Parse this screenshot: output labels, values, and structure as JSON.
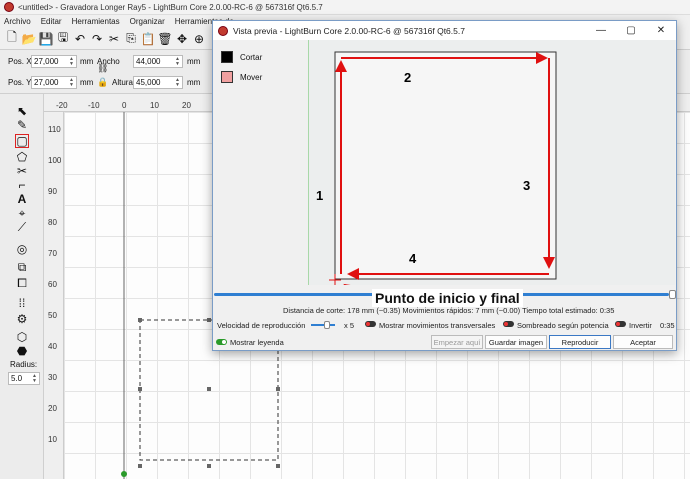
{
  "main_window": {
    "title": "<untitled> - Gravadora Longer Ray5 - LightBurn Core 2.0.00-RC-6 @ 567316f Qt6.5.7",
    "menu": [
      "Archivo",
      "Editar",
      "Herramientas",
      "Organizar",
      "Herramientas de"
    ]
  },
  "properties": {
    "pos_x_label": "Pos. X",
    "pos_x_value": "27,000",
    "pos_y_label": "Pos. Y",
    "pos_y_value": "27,000",
    "ancho_label": "Ancho",
    "ancho_value": "44,000",
    "altura_label": "Altura",
    "altura_value": "45,000",
    "unit": "mm"
  },
  "tools": {
    "radius_label": "Radius:",
    "radius_value": "5.0"
  },
  "rulers": {
    "top": [
      "-20",
      "-10",
      "0",
      "10",
      "20"
    ],
    "left": [
      "110",
      "100",
      "90",
      "80",
      "70",
      "60",
      "50",
      "40",
      "30",
      "20",
      "10"
    ]
  },
  "preview_dialog": {
    "title": "Vista previa - LightBurn Core 2.0.00-RC-6 @ 567316f Qt6.5.7",
    "legend": [
      {
        "label": "Cortar",
        "color": "#000000"
      },
      {
        "label": "Mover",
        "color": "#f0a0a0"
      }
    ],
    "path_labels": [
      "1",
      "2",
      "3",
      "4"
    ],
    "stats": "Distancia de corte: 178 mm (~0.35)   Movimientos rápidos: 7 mm (~0.00)   Tiempo total estimado: 0:35",
    "speed_label": "Velocidad de reproducción",
    "speed_multiplier": "x 5",
    "show_traversal_label": "Mostrar movimientos transversales",
    "shade_power_label": "Sombreado según potencia",
    "invert_label": "Invertir",
    "time": "0:35",
    "show_legend_label": "Mostrar leyenda",
    "buttons": {
      "start_here": "Empezar aquí",
      "save_image": "Guardar imagen",
      "play": "Reproducir",
      "accept": "Aceptar"
    },
    "progress": 1.0
  },
  "annotation": "Punto de inicio y final"
}
